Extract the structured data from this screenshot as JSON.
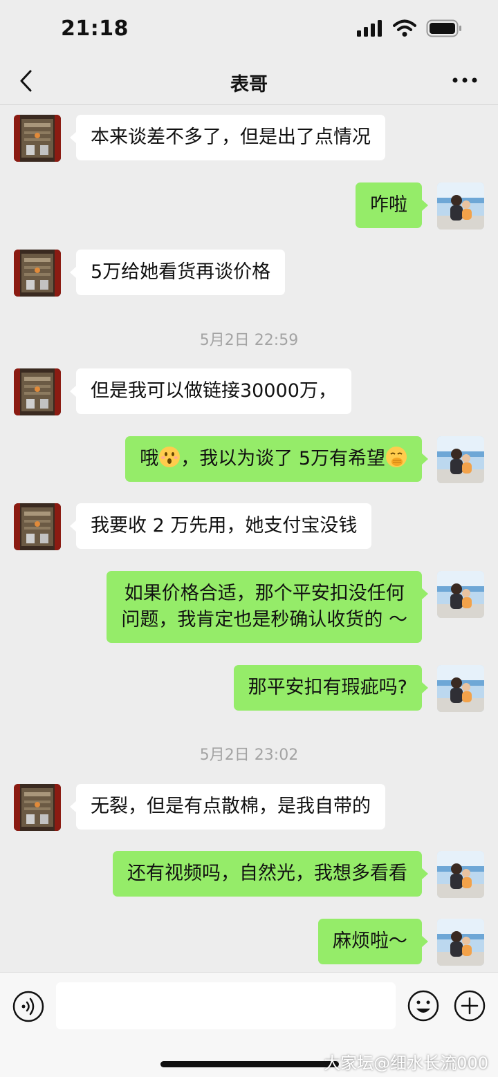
{
  "status_bar": {
    "time": "21:18",
    "battery_level": 1.0
  },
  "nav": {
    "title": "表哥",
    "back_icon": "chevron-left-icon",
    "more_icon": "more-dots-icon"
  },
  "messages": [
    {
      "side": "left",
      "text": "本来谈差不多了，但是出了点情况"
    },
    {
      "side": "right",
      "text": "咋啦"
    },
    {
      "side": "left",
      "text": "5万给她看货再谈价格"
    },
    {
      "timestamp": "5月2日 22:59"
    },
    {
      "side": "left",
      "text": "但是我可以做链接30000万，"
    },
    {
      "side": "right",
      "text_part1": "哦",
      "text_part2": "，我以为谈了 5万有希望",
      "emoji1": "hushed-face-emoji",
      "emoji2": "face-with-hand-over-mouth-emoji"
    },
    {
      "side": "left",
      "text": "我要收 2 万先用，她支付宝没钱"
    },
    {
      "side": "right",
      "line1": "如果价格合适，那个平安扣没任何",
      "line2": "问题，我肯定也是秒确认收货的 ～"
    },
    {
      "side": "right",
      "text": "那平安扣有瑕疵吗?"
    },
    {
      "timestamp": "5月2日 23:02"
    },
    {
      "side": "left",
      "text": "无裂，但是有点散棉，是我自带的"
    },
    {
      "side": "right",
      "text": "还有视频吗，自然光，我想多看看"
    },
    {
      "side": "right",
      "text": "麻烦啦～"
    }
  ],
  "input_bar": {
    "placeholder": "",
    "voice_icon": "voice-icon",
    "emoji_icon": "smiley-icon",
    "plus_icon": "plus-icon"
  },
  "watermark": "大家坛@细水长流000",
  "colors": {
    "background": "#ededed",
    "bubble_self": "#95ec69",
    "bubble_other": "#ffffff",
    "timestamp": "#a3a3a3"
  }
}
